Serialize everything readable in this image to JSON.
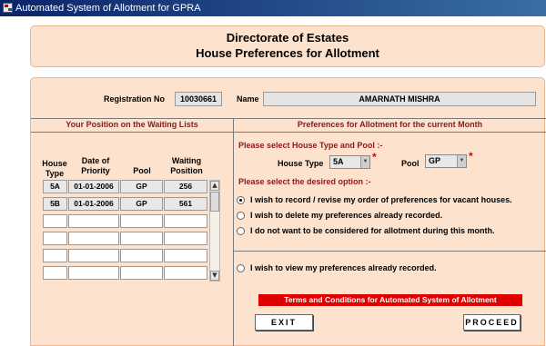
{
  "window": {
    "title": "Automated System of Allotment for GPRA"
  },
  "header": {
    "line1": "Directorate of Estates",
    "line2": "House Preferences for Allotment"
  },
  "applicant": {
    "registration_label": "Registration No",
    "registration_value": "10030661",
    "name_label": "Name",
    "name_value": "AMARNATH MISHRA"
  },
  "waiting_list": {
    "title": "Your Position on the Waiting Lists",
    "columns": [
      "House Type",
      "Date of Priority",
      "Pool",
      "Waiting Position"
    ],
    "rows": [
      [
        "5A",
        "01-01-2006",
        "GP",
        "256"
      ],
      [
        "5B",
        "01-01-2006",
        "GP",
        "561"
      ],
      [
        "",
        "",
        "",
        ""
      ],
      [
        "",
        "",
        "",
        ""
      ],
      [
        "",
        "",
        "",
        ""
      ],
      [
        "",
        "",
        "",
        ""
      ]
    ]
  },
  "preferences": {
    "title": "Preferences for Allotment for the current Month",
    "select_prompt": "Please select House Type and Pool :-",
    "house_type_label": "House Type",
    "house_type_value": "5A",
    "pool_label": "Pool",
    "pool_value": "GP",
    "required_mark": "*",
    "option_prompt": "Please select the desired option :-",
    "options": [
      {
        "label": "I wish to record / revise my order of  preferences for vacant houses.",
        "checked": true
      },
      {
        "label": "I wish to delete my preferences already recorded.",
        "checked": false
      },
      {
        "label": "I do not want to be considered for allotment during this month.",
        "checked": false
      },
      {
        "label": "I wish to view my preferences already recorded.",
        "checked": false
      }
    ],
    "terms_label": "Terms and Conditions for Automated System of Allotment",
    "exit_label": "EXIT",
    "proceed_label": "PROCEED"
  },
  "colors": {
    "panel": "#fde3ce",
    "section_title": "#8b1a1a",
    "terms_bar": "#e10000"
  }
}
